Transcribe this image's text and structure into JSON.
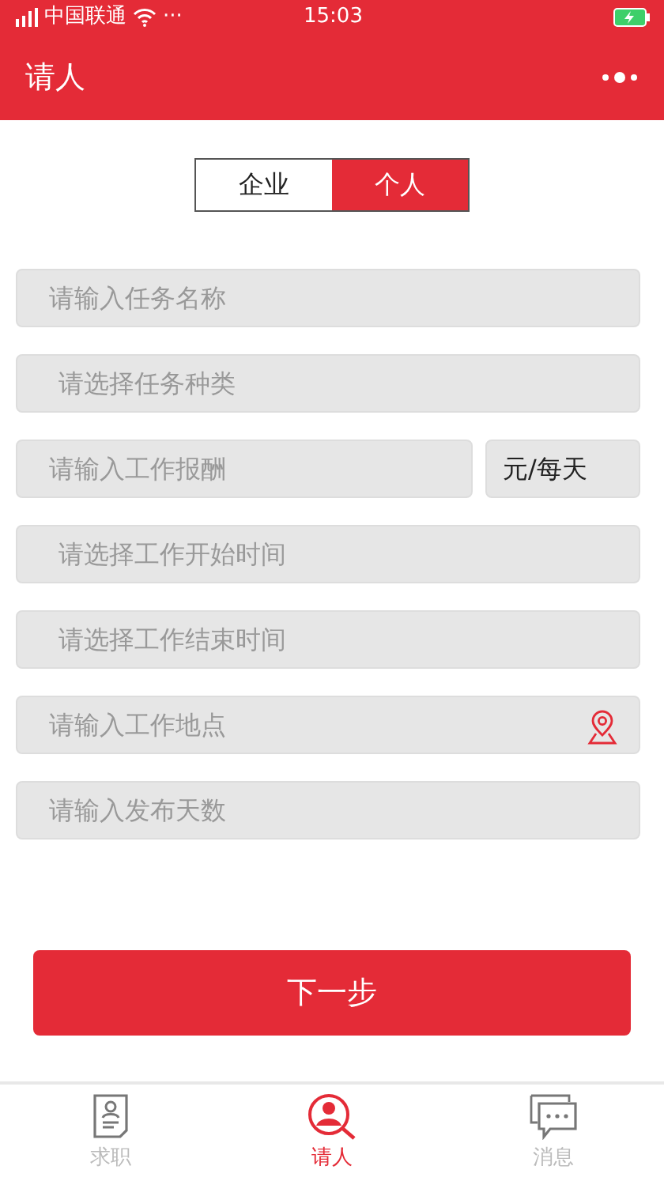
{
  "status_bar": {
    "carrier": "中国联通",
    "dots": "···",
    "time": "15:03",
    "charging": true
  },
  "header": {
    "title": "请人"
  },
  "segment": [
    {
      "label": "企业",
      "selected": false
    },
    {
      "label": "个人",
      "selected": true
    }
  ],
  "fields": [
    {
      "kind": "input",
      "placeholder": "请输入任务名称"
    },
    {
      "kind": "select",
      "placeholder": "请选择任务种类"
    },
    {
      "kind": "input",
      "placeholder": "请输入工作报酬",
      "unit": "元/每天"
    },
    {
      "kind": "select",
      "placeholder": "请选择工作开始时间"
    },
    {
      "kind": "select",
      "placeholder": "请选择工作结束时间"
    },
    {
      "kind": "location",
      "placeholder": "请输入工作地点"
    },
    {
      "kind": "input",
      "placeholder": "请输入发布天数"
    }
  ],
  "next_button": "下一步",
  "tab_bar": [
    {
      "kind": "resume",
      "label": "求职",
      "selected": false
    },
    {
      "kind": "person-search",
      "label": "请人",
      "selected": true
    },
    {
      "kind": "chat",
      "label": "消息",
      "selected": false
    }
  ]
}
